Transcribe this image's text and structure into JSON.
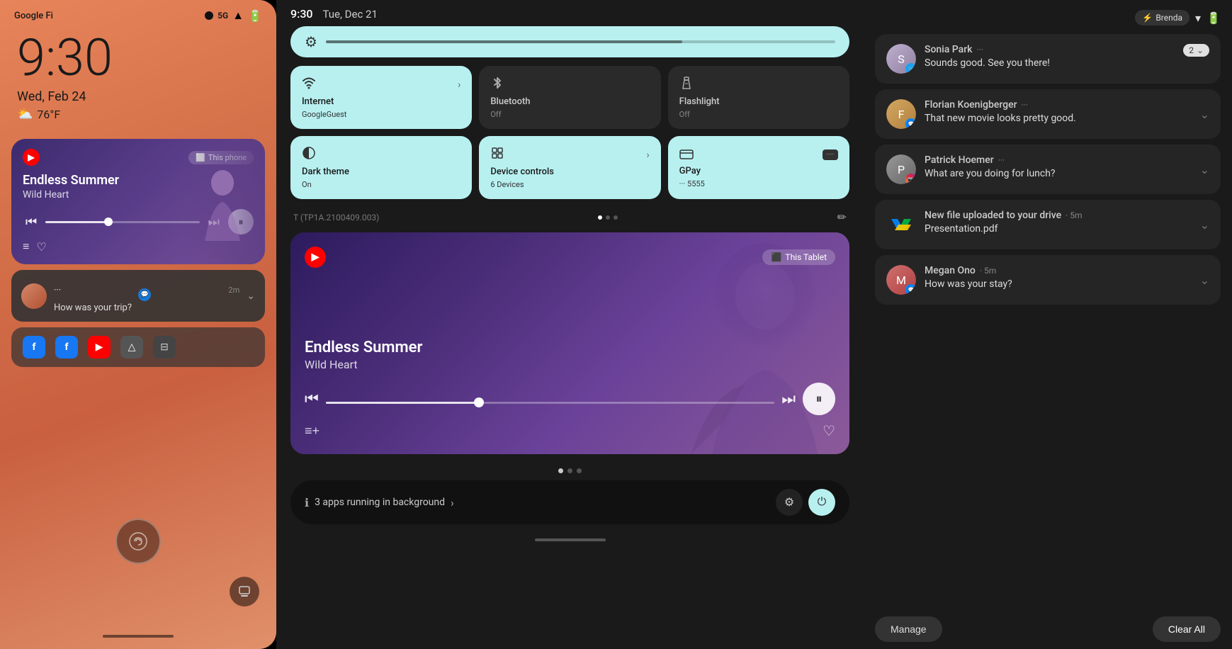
{
  "phone": {
    "carrier": "Google Fi",
    "network": "5G",
    "time": "9:30",
    "date": "Wed, Feb 24",
    "weather": "76°F",
    "music": {
      "title": "Endless Summer",
      "artist": "Wild Heart",
      "device": "This phone",
      "playing": true
    },
    "notification": {
      "sender": "...",
      "time": "2m",
      "message": "How was your trip?"
    },
    "shortcuts": [
      "f",
      "f",
      "▶",
      "△",
      "⊟"
    ]
  },
  "tablet": {
    "time": "9:30",
    "date": "Tue, Dec 21",
    "brightness_pct": 70,
    "quick_settings": [
      {
        "id": "internet",
        "title": "Internet",
        "subtitle": "GoogleGuest",
        "icon": "wifi",
        "active": true,
        "has_chevron": true
      },
      {
        "id": "bluetooth",
        "title": "Bluetooth",
        "subtitle": "Off",
        "icon": "bluetooth",
        "active": false,
        "has_chevron": false
      },
      {
        "id": "flashlight",
        "title": "Flashlight",
        "subtitle": "Off",
        "icon": "flashlight",
        "active": false,
        "has_chevron": false
      },
      {
        "id": "dark_theme",
        "title": "Dark theme",
        "subtitle": "On",
        "icon": "theme",
        "active": true,
        "has_chevron": false
      },
      {
        "id": "device_controls",
        "title": "Device controls",
        "subtitle": "6 Devices",
        "icon": "device",
        "active": true,
        "has_chevron": true
      },
      {
        "id": "gpay",
        "title": "GPay",
        "subtitle": "··· 5555",
        "icon": "gpay",
        "active": true,
        "has_chevron": false
      }
    ],
    "build": "T (TP1A.2100409.003)",
    "media": {
      "title": "Endless Summer",
      "artist": "Wild Heart",
      "device": "This Tablet",
      "playing": true
    },
    "bg_apps": "3 apps running in background"
  },
  "notifications": {
    "status": {
      "user": "Brenda",
      "wifi": true,
      "battery": 100
    },
    "items": [
      {
        "id": "sonia",
        "name": "Sonia Park",
        "avatar_color": "#b0a0c0",
        "time": "",
        "message": "Sounds good. See you there!",
        "count": "2",
        "has_badge": true,
        "badge_icon": "twitter"
      },
      {
        "id": "florian",
        "name": "Florian Koenigberger",
        "avatar_color": "#c09a60",
        "time": "",
        "message": "That new movie looks pretty good.",
        "count": "",
        "has_badge": true,
        "badge_icon": "messenger"
      },
      {
        "id": "patrick",
        "name": "Patrick Hoemer",
        "avatar_color": "#888",
        "time": "",
        "message": "What are you doing for lunch?",
        "count": "",
        "has_badge": true,
        "badge_icon": "instagram"
      },
      {
        "id": "drive",
        "name": "New file uploaded to your drive",
        "avatar_color": "#1976d2",
        "time": "5m",
        "message": "Presentation.pdf",
        "count": "",
        "has_badge": false,
        "badge_icon": "drive",
        "is_service": true
      },
      {
        "id": "megan",
        "name": "Megan Ono",
        "avatar_color": "#c05050",
        "time": "5m",
        "message": "How was your stay?",
        "count": "",
        "has_badge": true,
        "badge_icon": "messenger"
      }
    ],
    "manage_label": "Manage",
    "clear_all_label": "Clear All"
  }
}
